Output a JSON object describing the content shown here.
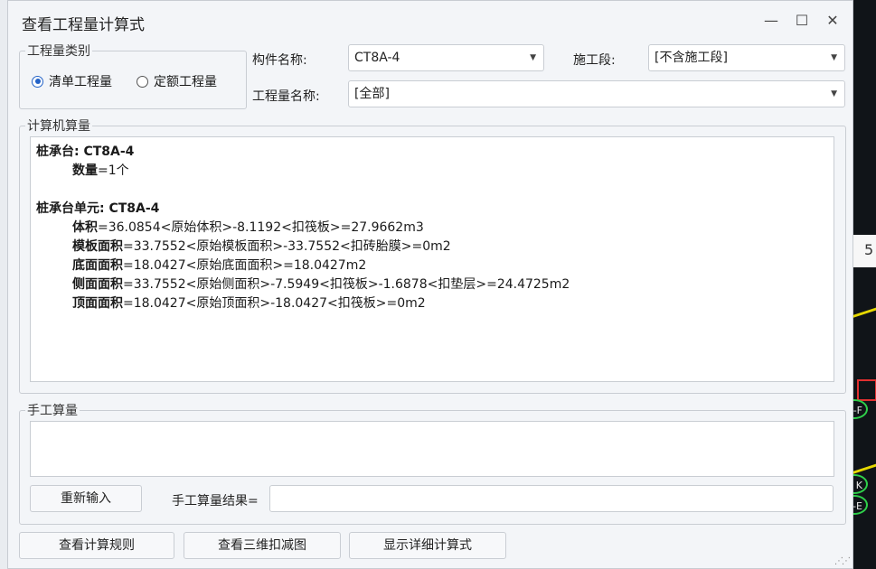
{
  "window": {
    "title": "查看工程量计算式",
    "minimize": "—",
    "maximize": "☐",
    "close": "✕"
  },
  "quantity_type": {
    "legend": "工程量类别",
    "options": [
      {
        "label": "清单工程量",
        "selected": true
      },
      {
        "label": "定额工程量",
        "selected": false
      }
    ]
  },
  "filters": {
    "component_label": "构件名称:",
    "component_value": "CT8A-4",
    "stage_label": "施工段:",
    "stage_value": "[不含施工段]",
    "qty_name_label": "工程量名称:",
    "qty_name_value": "[全部]"
  },
  "computer_calc": {
    "legend": "计算机算量",
    "group1_title": "桩承台: CT8A-4",
    "group1_lines": [
      {
        "name": "数量",
        "expr": "=1个"
      }
    ],
    "group2_title": "桩承台单元: CT8A-4",
    "group2_lines": [
      {
        "name": "体积",
        "expr": "=36.0854<原始体积>-8.1192<扣筏板>=27.9662m3"
      },
      {
        "name": "模板面积",
        "expr": "=33.7552<原始模板面积>-33.7552<扣砖胎膜>=0m2"
      },
      {
        "name": "底面面积",
        "expr": "=18.0427<原始底面面积>=18.0427m2"
      },
      {
        "name": "侧面面积",
        "expr": "=33.7552<原始侧面积>-7.5949<扣筏板>-1.6878<扣垫层>=24.4725m2"
      },
      {
        "name": "顶面面积",
        "expr": "=18.0427<原始顶面积>-18.0427<扣筏板>=0m2"
      }
    ]
  },
  "manual_calc": {
    "legend": "手工算量",
    "reenter_button": "重新输入",
    "result_label": "手工算量结果=",
    "result_value": ""
  },
  "bottom_buttons": {
    "view_rules": "查看计算规则",
    "view_3d": "查看三维扣减图",
    "show_detail": "显示详细计算式"
  },
  "background_app": {
    "edge_digit": "5",
    "axis_labels": [
      "-F",
      "-E"
    ],
    "axis_letter": "K"
  },
  "colors": {
    "radio_accent": "#2463c7",
    "axis_green": "#2fd04a",
    "outline_yellow": "#e6d800"
  }
}
